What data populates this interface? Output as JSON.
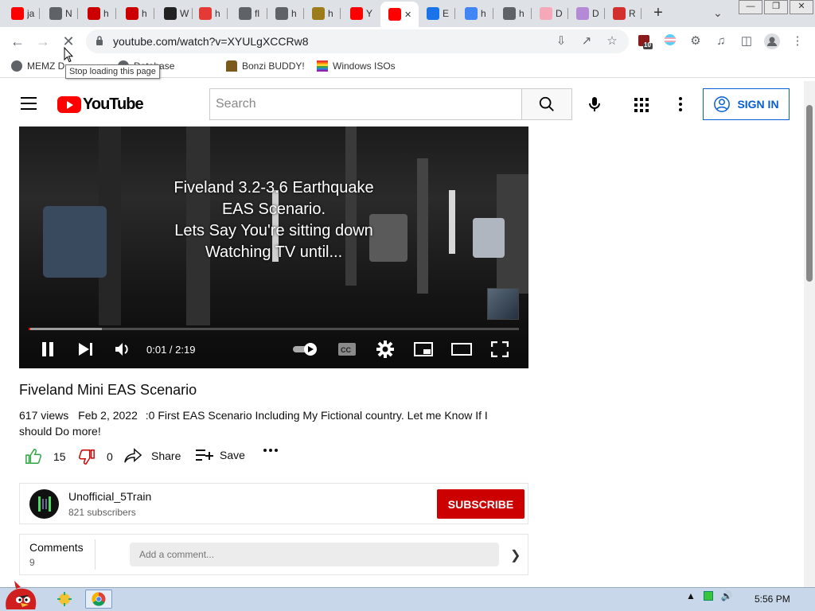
{
  "browser": {
    "tabs": [
      {
        "t": "ja",
        "color": "#ff0000"
      },
      {
        "t": "N",
        "color": "#5f6368"
      },
      {
        "t": "h",
        "color": "#cc0000"
      },
      {
        "t": "h",
        "color": "#cc0000"
      },
      {
        "t": "W",
        "color": "#222222"
      },
      {
        "t": "h",
        "color": "#e53935"
      },
      {
        "t": "fl",
        "color": "#5f6368"
      },
      {
        "t": "h",
        "color": "#5f6368"
      },
      {
        "t": "h",
        "color": "#9c7c1a"
      },
      {
        "t": "Y",
        "color": "#ff0000"
      },
      {
        "t": "",
        "color": "#ff0000"
      },
      {
        "t": "E",
        "color": "#1a73e8"
      },
      {
        "t": "h",
        "color": "#4285f4"
      },
      {
        "t": "h",
        "color": "#5f6368"
      },
      {
        "t": "D",
        "color": "#f5a9b8"
      },
      {
        "t": "D",
        "color": "#b48ad6"
      },
      {
        "t": "R",
        "color": "#d32f2f"
      }
    ],
    "new_tab": "+",
    "url": "youtube.com/watch?v=XYULgXCCRw8",
    "stop_tooltip": "Stop loading this page",
    "extension_badge": "10",
    "bookmarks": [
      {
        "label": "MEMZ D",
        "color": "#5f6368"
      },
      {
        "label": "Database",
        "color": "#5f6368"
      },
      {
        "label": "Bonzi BUDDY!",
        "color": "#7a5b1b"
      },
      {
        "label": "Windows ISOs",
        "color": "#e53935"
      }
    ]
  },
  "youtube": {
    "logo_text": "YouTube",
    "search_placeholder": "Search",
    "sign_in": "SIGN IN",
    "video": {
      "overlay_lines": [
        "Fiveland 3.2-3.6 Earthquake",
        "EAS Scenario.",
        "Lets Say You're sitting down",
        "Watching TV until..."
      ],
      "time": "0:01 / 2:19",
      "progress_played": 0.003,
      "progress_buffered": 0.15
    },
    "title": "Fiveland Mini EAS Scenario",
    "views": "617 views",
    "date": "Feb 2, 2022",
    "description": ":0 First EAS Scenario Including My Fictional country. Let me Know If I should Do more!",
    "likes": "15",
    "dislikes": "0",
    "share": "Share",
    "save": "Save",
    "channel_name": "Unofficial_5Train",
    "subscribers": "821 subscribers",
    "subscribe": "SUBSCRIBE",
    "comments_label": "Comments",
    "comments_count": "9",
    "comment_placeholder": "Add a comment..."
  },
  "taskbar": {
    "clock": "5:56 PM"
  }
}
